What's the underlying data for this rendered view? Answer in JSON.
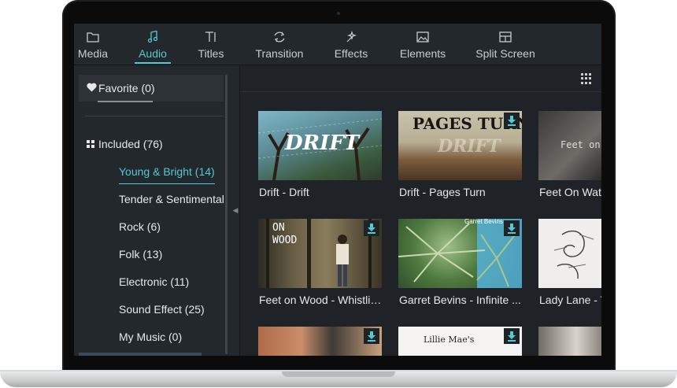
{
  "nav": {
    "tabs": [
      {
        "label": "Media",
        "icon": "folder-icon"
      },
      {
        "label": "Audio",
        "icon": "music-note-icon",
        "active": true
      },
      {
        "label": "Titles",
        "icon": "text-icon"
      },
      {
        "label": "Transition",
        "icon": "transition-icon"
      },
      {
        "label": "Effects",
        "icon": "sparkle-icon"
      },
      {
        "label": "Elements",
        "icon": "image-icon"
      },
      {
        "label": "Split Screen",
        "icon": "split-screen-icon"
      }
    ]
  },
  "sidebar": {
    "favorite": "Favorite (0)",
    "included": "Included (76)",
    "categories": [
      {
        "label": "Young & Bright (14)",
        "active": true
      },
      {
        "label": "Tender & Sentimental"
      },
      {
        "label": "Rock (6)"
      },
      {
        "label": "Folk (13)"
      },
      {
        "label": "Electronic (11)"
      },
      {
        "label": "Sound Effect (25)"
      },
      {
        "label": "My Music (0)"
      }
    ]
  },
  "cards": [
    {
      "title": "Drift - Drift",
      "overlay": "DRIFT"
    },
    {
      "title": "Drift - Pages Turn",
      "overlay": "PAGES TURN",
      "overlay2": "DRIFT"
    },
    {
      "title": "Feet On Water",
      "overlay": "Feet on"
    },
    {
      "title": "Feet on Wood - Whistlin...",
      "overlay": "ON",
      "overlay2": "WOOD"
    },
    {
      "title": "Garret Bevins - Infinite ...",
      "overlay": "Garret Bevins"
    },
    {
      "title": "Lady Lane - T",
      "overlay": ""
    },
    {
      "title": "",
      "overlay": ""
    },
    {
      "title": "",
      "overlay": "Lillie Mae's"
    },
    {
      "title": "",
      "overlay": ""
    }
  ],
  "colors": {
    "accent": "#54c9d3",
    "bg": "#202529",
    "text": "#e6e8ea"
  }
}
